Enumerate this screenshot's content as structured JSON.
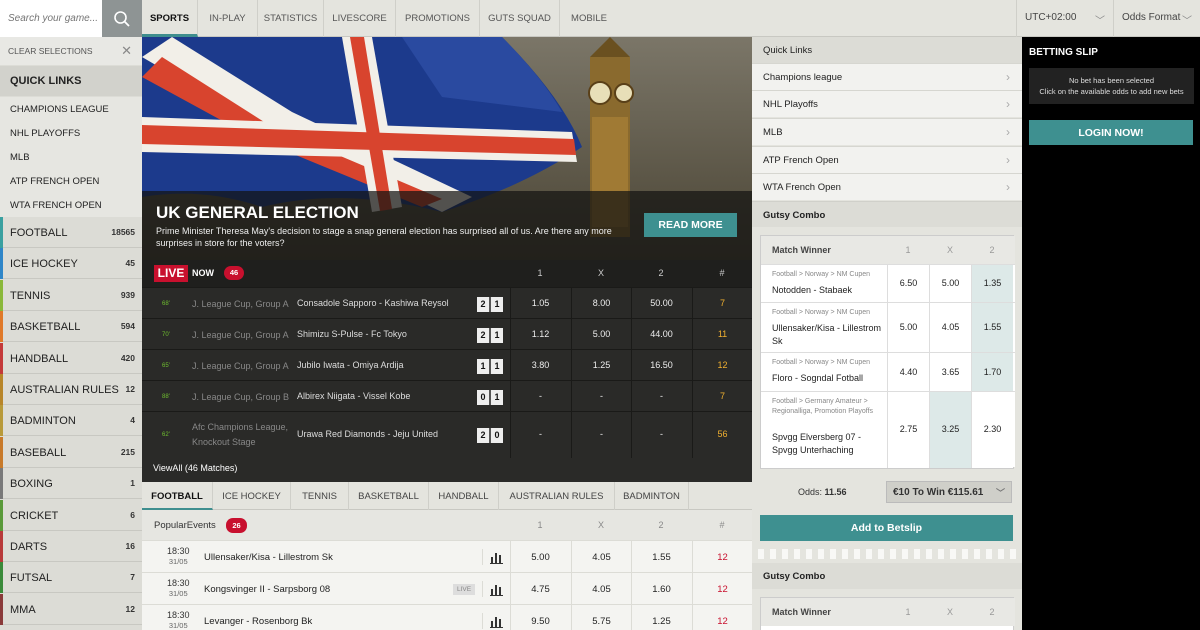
{
  "search": {
    "placeholder": "Search your game..."
  },
  "sidebar": {
    "clear_label": "CLEAR SELECTIONS",
    "quick_links_title": "QUICK LINKS",
    "quick_links": [
      "CHAMPIONS LEAGUE",
      "NHL PLAYOFFS",
      "MLB",
      "ATP FRENCH OPEN",
      "WTA FRENCH OPEN"
    ],
    "sports": [
      {
        "name": "FOOTBALL",
        "count": "18565",
        "color": "#3aa0a0"
      },
      {
        "name": "ICE HOCKEY",
        "count": "45",
        "color": "#2f86c8"
      },
      {
        "name": "TENNIS",
        "count": "939",
        "color": "#8ab83a"
      },
      {
        "name": "BASKETBALL",
        "count": "594",
        "color": "#e07a2a"
      },
      {
        "name": "HANDBALL",
        "count": "420",
        "color": "#c43a3a"
      },
      {
        "name": "AUSTRALIAN RULES",
        "count": "12",
        "color": "#b8862a"
      },
      {
        "name": "BADMINTON",
        "count": "4",
        "color": "#b89a3a"
      },
      {
        "name": "BASEBALL",
        "count": "215",
        "color": "#c87a2a"
      },
      {
        "name": "BOXING",
        "count": "1",
        "color": "#7a7a7a"
      },
      {
        "name": "CRICKET",
        "count": "6",
        "color": "#5a9a3a"
      },
      {
        "name": "DARTS",
        "count": "16",
        "color": "#b83a3a"
      },
      {
        "name": "FUTSAL",
        "count": "7",
        "color": "#3a8a3a"
      },
      {
        "name": "MMA",
        "count": "12",
        "color": "#8a3a3a"
      }
    ]
  },
  "topnav": {
    "items": [
      "SPORTS",
      "IN-PLAY",
      "STATISTICS",
      "LIVESCORE",
      "PROMOTIONS",
      "GUTS SQUAD",
      "MOBILE"
    ],
    "timezone": "UTC+02:00",
    "odds_format": "Odds Format"
  },
  "hero": {
    "title": "UK GENERAL ELECTION",
    "description": "Prime Minister Theresa May's decision to stage a snap general election has surprised all of us. Are there any more surprises in store for the voters?",
    "cta": "READ MORE"
  },
  "live": {
    "badge": "LIVE",
    "now": "NOW",
    "count": "46",
    "cols": [
      "1",
      "X",
      "2",
      "#"
    ],
    "rows": [
      {
        "min": "68'",
        "league": "J. League Cup, Group A",
        "teams": "Consadole Sapporo - Kashiwa Reysol",
        "s1": "2",
        "s2": "1",
        "o1": "1.05",
        "ox": "8.00",
        "o2": "50.00",
        "more": "7"
      },
      {
        "min": "70'",
        "league": "J. League Cup, Group A",
        "teams": "Shimizu S-Pulse - Fc Tokyo",
        "s1": "2",
        "s2": "1",
        "o1": "1.12",
        "ox": "5.00",
        "o2": "44.00",
        "more": "11"
      },
      {
        "min": "65'",
        "league": "J. League Cup, Group A",
        "teams": "Jubilo Iwata - Omiya Ardija",
        "s1": "1",
        "s2": "1",
        "o1": "3.80",
        "ox": "1.25",
        "o2": "16.50",
        "more": "12"
      },
      {
        "min": "88'",
        "league": "J. League Cup, Group B",
        "teams": "Albirex Niigata - Vissel Kobe",
        "s1": "0",
        "s2": "1",
        "o1": "-",
        "ox": "-",
        "o2": "-",
        "more": "7"
      },
      {
        "min": "62'",
        "league": "Afc Champions League, Knockout Stage",
        "teams": "Urawa Red Diamonds - Jeju United",
        "s1": "2",
        "s2": "0",
        "o1": "-",
        "ox": "-",
        "o2": "-",
        "more": "56"
      }
    ],
    "view_all": "ViewAll (46 Matches)"
  },
  "sport_tabs": [
    "FOOTBALL",
    "ICE HOCKEY",
    "TENNIS",
    "BASKETBALL",
    "HANDBALL",
    "AUSTRALIAN RULES",
    "BADMINTON"
  ],
  "popular": {
    "title": "PopularEvents",
    "count": "26",
    "cols": [
      "1",
      "X",
      "2",
      "#"
    ],
    "rows": [
      {
        "time": "18:30",
        "date": "31/05",
        "teams": "Ullensaker/Kisa - Lillestrom Sk",
        "live": "",
        "o1": "5.00",
        "ox": "4.05",
        "o2": "1.55",
        "more": "12"
      },
      {
        "time": "18:30",
        "date": "31/05",
        "teams": "Kongsvinger II - Sarpsborg 08",
        "live": "LIVE",
        "o1": "4.75",
        "ox": "4.05",
        "o2": "1.60",
        "more": "12"
      },
      {
        "time": "18:30",
        "date": "31/05",
        "teams": "Levanger - Rosenborg Bk",
        "live": "",
        "o1": "9.50",
        "ox": "5.75",
        "o2": "1.25",
        "more": "12"
      }
    ]
  },
  "quick_links_right": {
    "title": "Quick Links",
    "items": [
      "Champions league",
      "NHL Playoffs",
      "MLB",
      "ATP French Open",
      "WTA French Open"
    ]
  },
  "gutsy": {
    "title": "Gutsy Combo",
    "market": "Match Winner",
    "cols": [
      "1",
      "X",
      "2"
    ],
    "rows": [
      {
        "path": "Football > Norway > NM Cupen",
        "teams": "Notodden - Stabaek",
        "o1": "6.50",
        "ox": "5.00",
        "o2": "1.35",
        "sel": 2
      },
      {
        "path": "Football > Norway > NM Cupen",
        "teams": "Ullensaker/Kisa - Lillestrom Sk",
        "o1": "5.00",
        "ox": "4.05",
        "o2": "1.55",
        "sel": 2
      },
      {
        "path": "Football > Norway > NM Cupen",
        "teams": "Floro - Sogndal Fotball",
        "o1": "4.40",
        "ox": "3.65",
        "o2": "1.70",
        "sel": 2
      },
      {
        "path": "Football > Germany Amateur > Regionalliga, Promotion Playoffs",
        "teams": "Spvgg Elversberg 07 - Spvgg Unterhaching",
        "o1": "2.75",
        "ox": "3.25",
        "o2": "2.30",
        "sel": 1
      }
    ],
    "odds_label": "Odds:",
    "odds_value": "11.56",
    "stake": "€10 To Win €115.61",
    "add_button": "Add to Betslip",
    "title2": "Gutsy Combo",
    "market2": "Match Winner"
  },
  "slip": {
    "title": "BETTING SLIP",
    "msg1": "No bet has been selected",
    "msg2": "Click on the available odds to add new bets",
    "login": "LOGIN NOW!"
  },
  "colors": {
    "accent": "#3e9090",
    "live_red": "#c8102e"
  }
}
